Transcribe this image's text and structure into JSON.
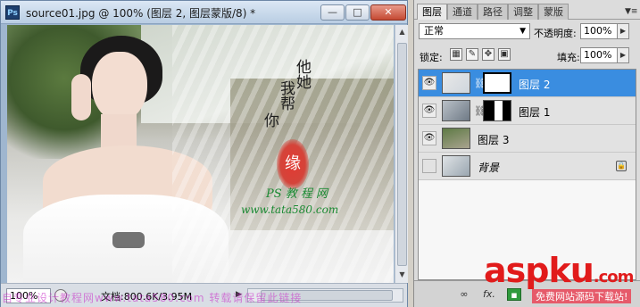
{
  "document": {
    "app_icon": "Ps",
    "title": "source01.jpg @ 100% (图层 2, 图层蒙版/8) *",
    "buttons": {
      "minimize": "—",
      "maximize": "□",
      "close": "✕"
    },
    "canvas": {
      "poem_line1": "他她",
      "poem_line2": "我帮",
      "poem_line3": "你",
      "seal_text": "缘",
      "brand_line1": "PS 教 程 网",
      "brand_line2": "www.tata580.com"
    },
    "status": {
      "zoom": "100%",
      "doc_info": "文档:800.6K/3.95M"
    },
    "bottom_watermark": "自专业设计教程网www.tata580.com  转载请保留此链接"
  },
  "layers_panel": {
    "tabs": [
      "图层",
      "通道",
      "路径",
      "调整",
      "蒙版"
    ],
    "active_tab": "图层",
    "blend_mode": "正常",
    "opacity_label": "不透明度:",
    "opacity_value": "100%",
    "lock_label": "锁定:",
    "fill_label": "填充:",
    "fill_value": "100%",
    "layers": [
      {
        "name": "图层 2",
        "visible": true,
        "selected": true,
        "has_mask": true
      },
      {
        "name": "图层 1",
        "visible": true,
        "selected": false,
        "has_mask": true
      },
      {
        "name": "图层 3",
        "visible": true,
        "selected": false,
        "has_mask": false
      },
      {
        "name": "背景",
        "visible": false,
        "selected": false,
        "has_mask": false,
        "locked": true
      }
    ],
    "footer": {
      "link_icon": "∞",
      "fx_icon": "fx.",
      "brand": "aspku",
      "brand_tld": ".com",
      "brand_sub": "免费网站源码下载站!"
    }
  },
  "colors": {
    "selection": "#3a8de0",
    "brand_red": "#e11b1b",
    "brand_green": "#1b8a33"
  }
}
